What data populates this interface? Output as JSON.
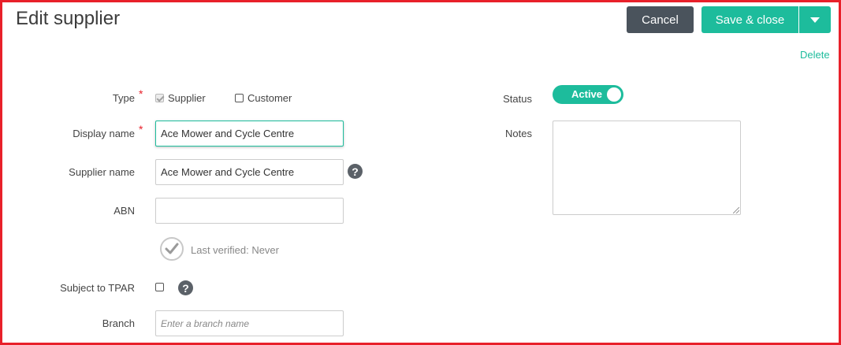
{
  "header": {
    "title": "Edit supplier",
    "cancel_label": "Cancel",
    "save_label": "Save & close",
    "delete_label": "Delete"
  },
  "form": {
    "type": {
      "label": "Type",
      "options": [
        {
          "label": "Supplier",
          "checked": true
        },
        {
          "label": "Customer",
          "checked": false
        }
      ]
    },
    "display_name": {
      "label": "Display name",
      "value": "Ace Mower and Cycle Centre"
    },
    "supplier_name": {
      "label": "Supplier name",
      "value": "Ace Mower and Cycle Centre"
    },
    "abn": {
      "label": "ABN",
      "value": "",
      "verified_text": "Last verified: Never"
    },
    "tpar": {
      "label": "Subject to TPAR",
      "checked": false
    },
    "branch": {
      "label": "Branch",
      "placeholder": "Enter a branch name"
    },
    "status": {
      "label": "Status",
      "value": "Active"
    },
    "notes": {
      "label": "Notes",
      "value": ""
    }
  },
  "colors": {
    "accent": "#1dbc9c",
    "cancel_bg": "#4a535c",
    "frame_border": "#e8202a",
    "required": "#e8202a"
  },
  "icons": {
    "help": "question-circle-icon",
    "verify": "check-circle-icon",
    "dropdown": "caret-down-icon"
  }
}
